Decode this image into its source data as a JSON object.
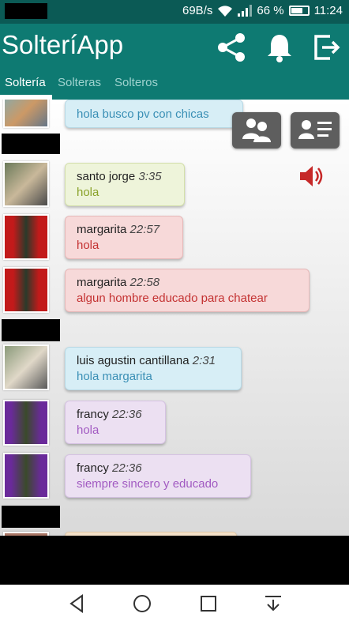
{
  "status": {
    "speed": "69B/s",
    "battery": "66 %",
    "clock": "11:24"
  },
  "app": {
    "title": "SolteríApp"
  },
  "tabs": [
    {
      "label": "Soltería",
      "active": true
    },
    {
      "label": "Solteras",
      "active": false
    },
    {
      "label": "Solteros",
      "active": false
    }
  ],
  "messages": [
    {
      "sender": "",
      "time": "",
      "text": "hola busco pv con chicas",
      "color": "blue"
    },
    {
      "sender": "santo jorge",
      "time": "3:35",
      "text": "hola",
      "color": "green"
    },
    {
      "sender": "margarita",
      "time": "22:57",
      "text": "hola",
      "color": "red"
    },
    {
      "sender": "margarita",
      "time": "22:58",
      "text": "algun hombre educado para chatear",
      "color": "red"
    },
    {
      "sender": "luis agustin cantillana",
      "time": "2:31",
      "text": "hola margarita",
      "color": "blue"
    },
    {
      "sender": "francy",
      "time": "22:36",
      "text": "hola",
      "color": "purple"
    },
    {
      "sender": "francy",
      "time": "22:36",
      "text": "siempre sincero y educado",
      "color": "purple"
    }
  ],
  "icons": {
    "share": "share-icon",
    "bell": "bell-icon",
    "exit": "exit-icon",
    "group": "group-icon",
    "contact_card": "contact-card-icon",
    "speaker": "speaker-icon"
  },
  "colors": {
    "primary": "#0e7a72",
    "status_bar": "#0b5a55",
    "speaker": "#c62828"
  }
}
